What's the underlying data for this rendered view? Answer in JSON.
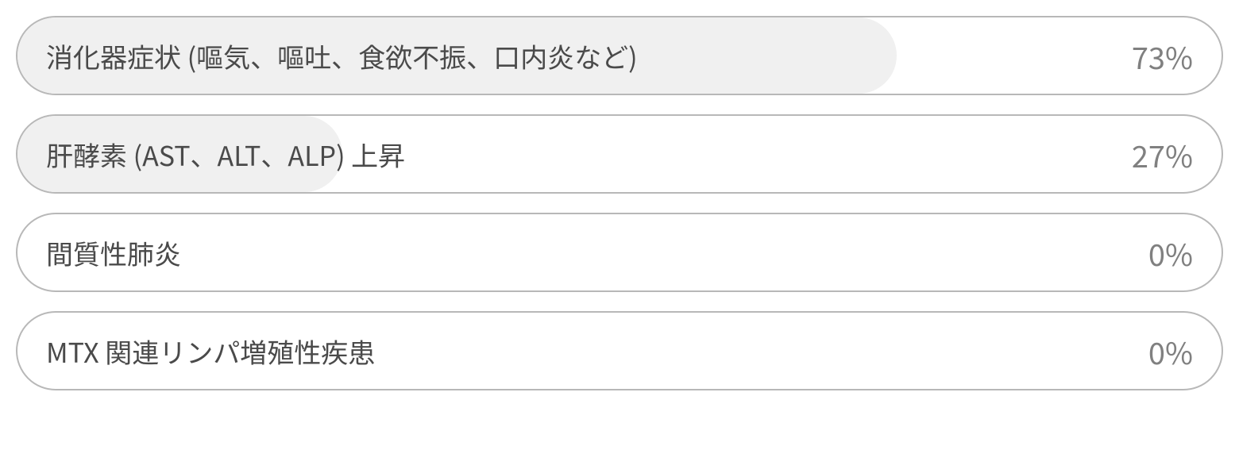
{
  "chart_data": {
    "type": "bar",
    "categories": [
      "消化器症状 (嘔気、嘔吐、食欲不振、口内炎など)",
      "肝酵素 (AST、ALT、ALP) 上昇",
      "間質性肺炎",
      "MTX 関連リンパ増殖性疾患"
    ],
    "values": [
      73,
      27,
      0,
      0
    ],
    "value_labels": [
      "73%",
      "27%",
      "0%",
      "0%"
    ],
    "title": "",
    "xlabel": "",
    "ylabel": "",
    "ylim": [
      0,
      100
    ]
  },
  "colors": {
    "border": "#b8b8b8",
    "fill": "#f0f0f0",
    "text_label": "#4a4a4a",
    "text_value": "#808080"
  }
}
